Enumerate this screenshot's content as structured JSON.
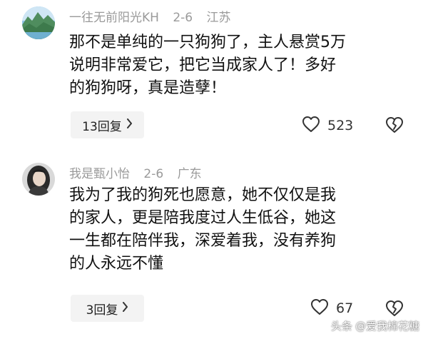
{
  "comments": [
    {
      "username": "一往无前阳光KH",
      "date": "2-6",
      "location": "江苏",
      "lines": [
        "那不是单纯的一只狗狗了，主人悬赏5万",
        "说明非常爱它，把它当成家人了！多好",
        "的狗狗呀，真是造孽！"
      ],
      "reply_label": "13回复",
      "likes": "523",
      "avatar_icon": "landscape-avatar"
    },
    {
      "username": "我是甄小怡",
      "date": "2-6",
      "location": "广东",
      "lines": [
        "我为了我的狗死也愿意，她不仅仅是我",
        "的家人，更是陪我度过人生低谷，她这",
        "一生都在陪伴我，深爱着我，没有养狗",
        "的人永远不懂"
      ],
      "reply_label": "3回复",
      "likes": "67",
      "avatar_icon": "portrait-avatar"
    }
  ],
  "icons": {
    "like": "heart-outline-icon",
    "dislike": "broken-heart-icon",
    "chevron": "chevron-right-icon"
  },
  "watermark": {
    "prefix": "头条",
    "handle": "@爱我棉花糖"
  }
}
